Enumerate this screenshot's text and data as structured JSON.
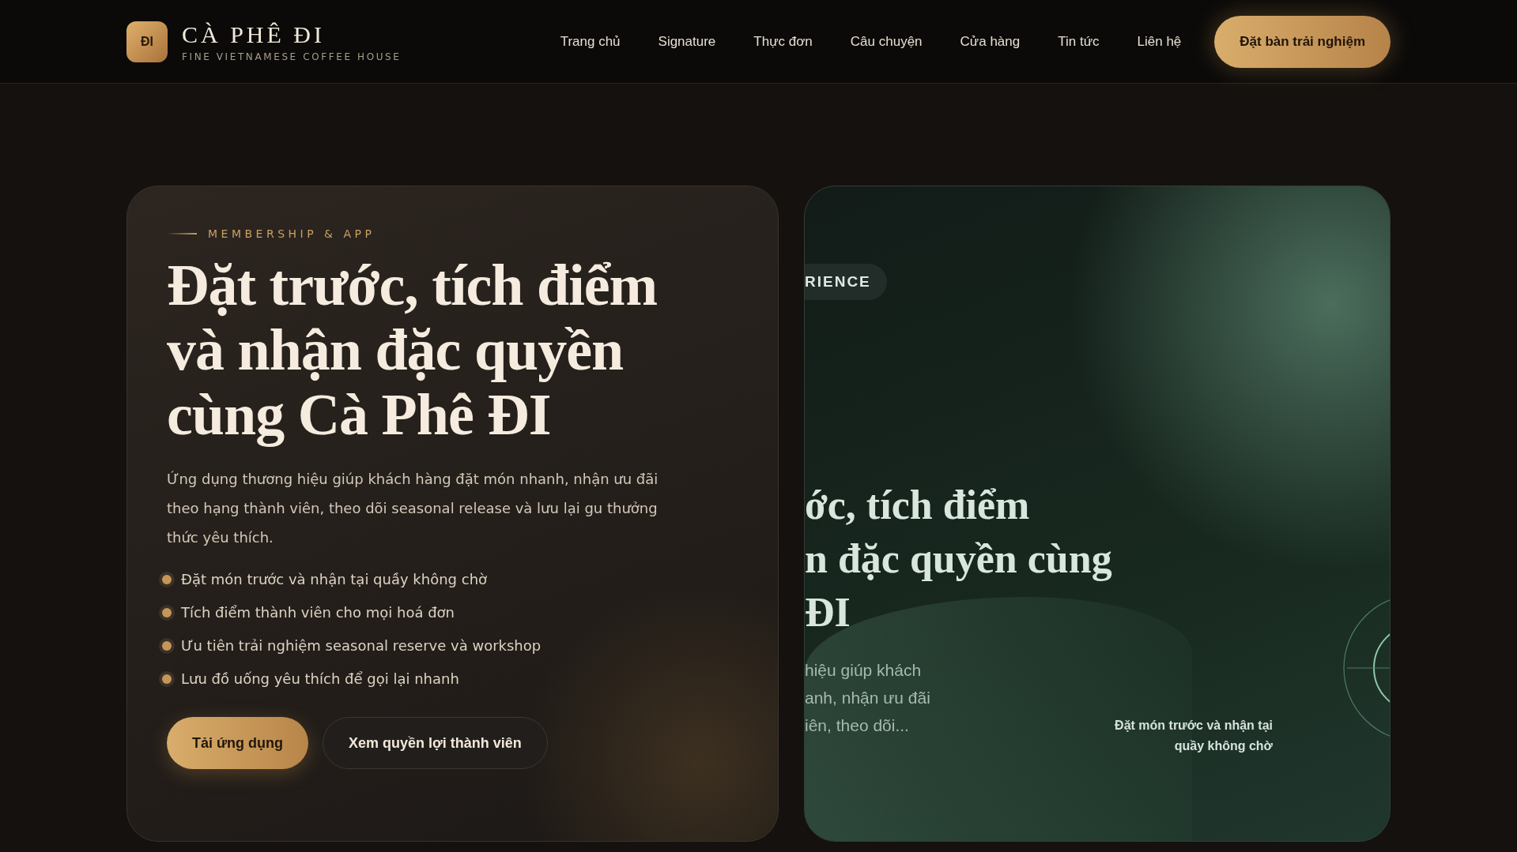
{
  "brand": {
    "mark": "ĐI",
    "name": "CÀ PHÊ ĐI",
    "tagline": "FINE VIETNAMESE COFFEE HOUSE"
  },
  "nav": [
    {
      "label": "Trang chủ"
    },
    {
      "label": "Signature"
    },
    {
      "label": "Thực đơn"
    },
    {
      "label": "Câu chuyện"
    },
    {
      "label": "Cửa hàng"
    },
    {
      "label": "Tin tức"
    },
    {
      "label": "Liên hệ"
    }
  ],
  "cta": "Đặt bàn trải nghiệm",
  "membership": {
    "eyebrow": "MEMBERSHIP & APP",
    "title_lines": [
      "Đặt trước, tích điểm",
      "và nhận đặc quyền",
      "cùng Cà Phê ĐI"
    ],
    "description": "Ứng dụng thương hiệu giúp khách hàng đặt món nhanh, nhận ưu đãi theo hạng thành viên, theo dõi seasonal release và lưu lại gu thưởng thức yêu thích.",
    "benefits": [
      "Đặt món trước và nhận tại quầy không chờ",
      "Tích điểm thành viên cho mọi hoá đơn",
      "Ưu tiên trải nghiệm seasonal reserve và workshop",
      "Lưu đồ uống yêu thích để gọi lại nhanh"
    ],
    "buttons": [
      {
        "label": "Tải ứng dụng",
        "kind": "primary"
      },
      {
        "label": "Xem quyền lợi thành viên",
        "kind": "secondary"
      }
    ]
  },
  "preview": {
    "badge": "RIENCE",
    "title_lines": [
      "ớc, tích điểm",
      "n đặc quyền cùng",
      "ĐI"
    ],
    "text_lines": [
      "hiệu giúp khách",
      "anh, nhận ưu đãi",
      "iên, theo dõi..."
    ],
    "caption": "Đặt món trước và nhận tại quầy không chờ"
  }
}
